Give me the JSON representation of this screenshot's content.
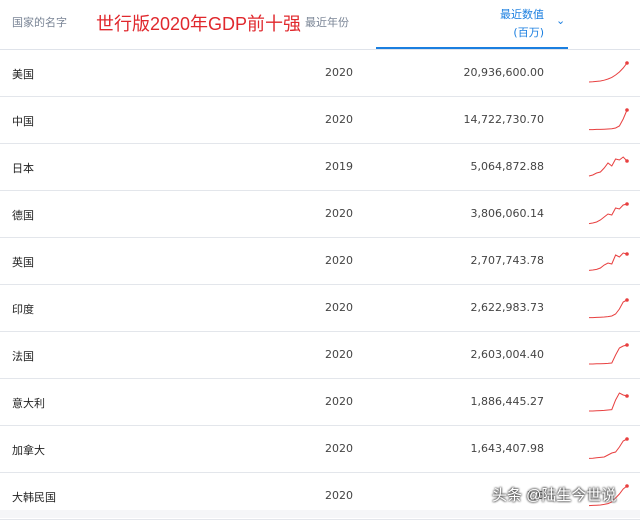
{
  "header": {
    "country_col": "国家的名字",
    "title": "世行版2020年GDP前十强",
    "year_col": "最近年份",
    "value_col_line1": "最近数值",
    "value_col_line2": "(百万)",
    "sort_icon": "chevron-down-icon"
  },
  "rows": [
    {
      "country": "美国",
      "year": "2020",
      "value": "20,936,600.00",
      "trend": [
        0.05,
        0.06,
        0.08,
        0.1,
        0.14,
        0.2,
        0.28,
        0.4,
        0.55,
        0.75,
        1.0
      ]
    },
    {
      "country": "中国",
      "year": "2020",
      "value": "14,722,730.70",
      "trend": [
        0.02,
        0.02,
        0.03,
        0.03,
        0.04,
        0.05,
        0.06,
        0.1,
        0.2,
        0.55,
        1.0
      ]
    },
    {
      "country": "日本",
      "year": "2019",
      "value": "5,064,872.88",
      "trend": [
        0.05,
        0.1,
        0.2,
        0.25,
        0.45,
        0.7,
        0.55,
        0.9,
        0.85,
        1.0,
        0.8
      ]
    },
    {
      "country": "德国",
      "year": "2020",
      "value": "3,806,060.14",
      "trend": [
        0.02,
        0.05,
        0.1,
        0.2,
        0.35,
        0.5,
        0.45,
        0.8,
        0.75,
        0.95,
        1.0
      ]
    },
    {
      "country": "英国",
      "year": "2020",
      "value": "2,707,743.78",
      "trend": [
        0.03,
        0.05,
        0.08,
        0.15,
        0.3,
        0.4,
        0.35,
        0.8,
        0.7,
        0.9,
        0.85
      ]
    },
    {
      "country": "印度",
      "year": "2020",
      "value": "2,622,983.73",
      "trend": [
        0.02,
        0.02,
        0.03,
        0.04,
        0.05,
        0.07,
        0.1,
        0.2,
        0.45,
        0.8,
        0.9
      ]
    },
    {
      "country": "法国",
      "year": "2020",
      "value": "2,603,004.40",
      "trend": [
        0.05,
        0.05,
        0.06,
        0.06,
        0.07,
        0.08,
        0.1,
        0.5,
        0.85,
        0.95,
        1.0
      ]
    },
    {
      "country": "意大利",
      "year": "2020",
      "value": "1,886,445.27",
      "trend": [
        0.05,
        0.05,
        0.06,
        0.07,
        0.08,
        0.1,
        0.12,
        0.6,
        0.95,
        0.85,
        0.8
      ]
    },
    {
      "country": "加拿大",
      "year": "2020",
      "value": "1,643,407.98",
      "trend": [
        0.03,
        0.04,
        0.06,
        0.08,
        0.1,
        0.2,
        0.3,
        0.35,
        0.6,
        0.9,
        1.0
      ]
    },
    {
      "country": "大韩民国",
      "year": "2020",
      "value": "1,6",
      "trend": [
        0.02,
        0.03,
        0.04,
        0.05,
        0.08,
        0.12,
        0.2,
        0.4,
        0.6,
        0.85,
        1.0
      ]
    }
  ],
  "watermark": "头条 @陆生今世说",
  "colors": {
    "accent": "#1b7fe0",
    "title": "#e0282d",
    "sparkline": "#e84040"
  }
}
